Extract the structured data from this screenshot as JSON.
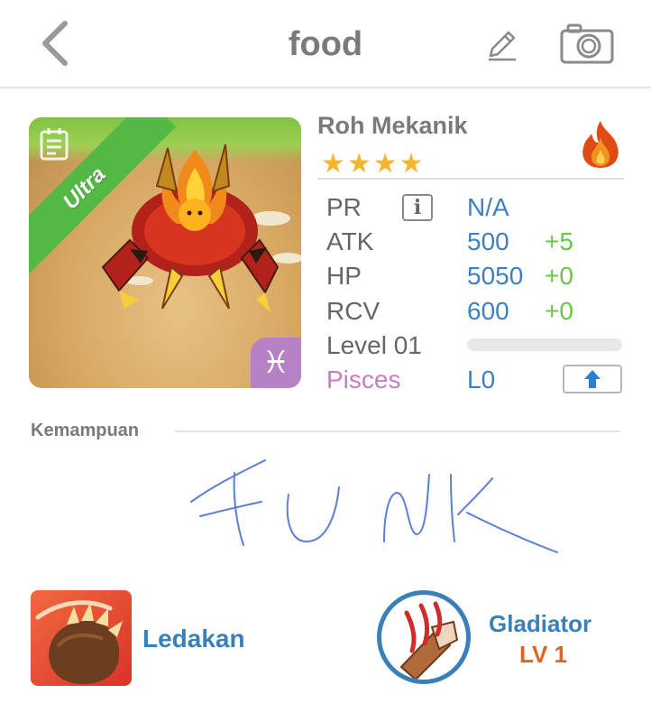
{
  "header": {
    "title": "food",
    "back_icon": "chevron-left-icon",
    "edit_icon": "pencil-icon",
    "camera_icon": "camera-icon"
  },
  "card": {
    "rarity": "Ultra",
    "zodiac_symbol": "♓",
    "colors": {
      "ribbon": "#54b844",
      "zodiac_badge": "#b781c5"
    }
  },
  "monster": {
    "name": "Roh Mekanik",
    "stars": "★★★★",
    "element_icon": "fire-icon"
  },
  "stats": {
    "pr": {
      "label": "PR",
      "value": "N/A"
    },
    "atk": {
      "label": "ATK",
      "value": "500",
      "bonus": "+5"
    },
    "hp": {
      "label": "HP",
      "value": "5050",
      "bonus": "+0"
    },
    "rcv": {
      "label": "RCV",
      "value": "600",
      "bonus": "+0"
    },
    "level": {
      "label": "Level 01",
      "progress": 0
    },
    "zodiac": {
      "label": "Pisces",
      "value": "L0"
    }
  },
  "skills": {
    "section_title": "Kemampuan",
    "active": {
      "name": "Ledakan"
    },
    "leader": {
      "name": "Gladiator",
      "level": "LV 1"
    }
  },
  "colors": {
    "value_blue": "#3f7fbf",
    "bonus_green": "#6ec44a",
    "pisces_purple": "#c27fc3",
    "level_orange": "#e0641f"
  }
}
